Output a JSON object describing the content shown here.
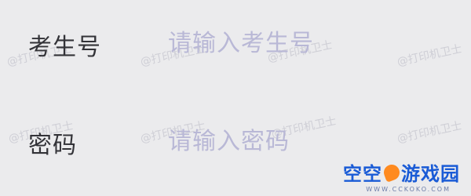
{
  "form": {
    "exam_number": {
      "label": "考生号",
      "value": "",
      "placeholder": "请输入考生号"
    },
    "password": {
      "label": "密码",
      "value": "",
      "placeholder": "请输入密码"
    }
  },
  "watermark": {
    "text": "@打印机卫士"
  },
  "brand": {
    "name_part1": "空空",
    "name_part2": "游戏园",
    "url": "WWW.CCKOKO.COM"
  }
}
